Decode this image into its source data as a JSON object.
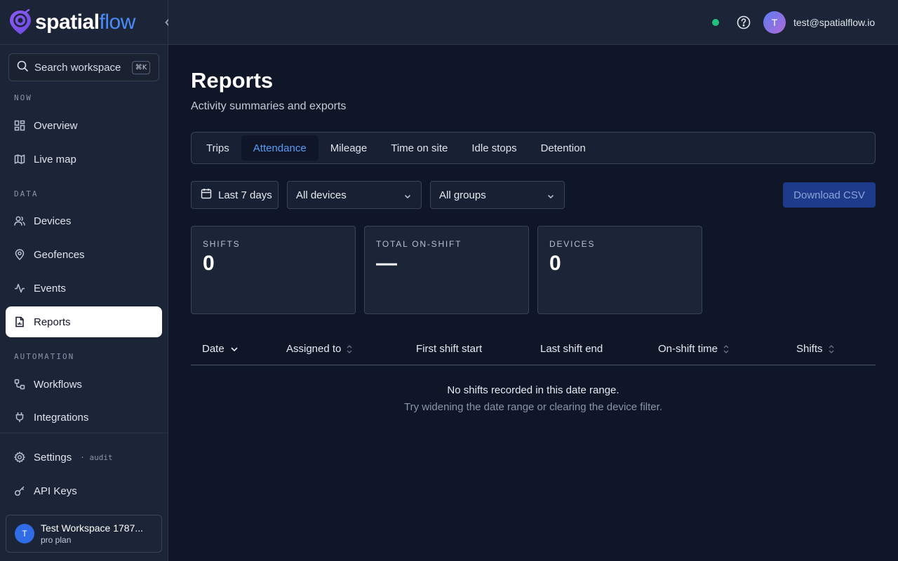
{
  "brand": {
    "word_part1": "spatial",
    "word_part2": "flow"
  },
  "search": {
    "placeholder": "Search workspace",
    "shortcut": "⌘K"
  },
  "sidebar": {
    "sections": {
      "now": "NOW",
      "data": "DATA",
      "automation": "AUTOMATION"
    },
    "items": [
      {
        "label": "Overview"
      },
      {
        "label": "Live map"
      },
      {
        "label": "Devices"
      },
      {
        "label": "Geofences"
      },
      {
        "label": "Events"
      },
      {
        "label": "Reports"
      },
      {
        "label": "Workflows"
      },
      {
        "label": "Integrations"
      },
      {
        "label": "Settings",
        "tag": "· audit"
      },
      {
        "label": "API Keys"
      }
    ],
    "workspace": {
      "avatar": "T",
      "name": "Test Workspace 1787...",
      "plan": "pro plan"
    }
  },
  "topbar": {
    "status_color": "#22c07a",
    "avatar": "T",
    "email": "test@spatialflow.io"
  },
  "page": {
    "title": "Reports",
    "subtitle": "Activity summaries and exports"
  },
  "tabs": [
    {
      "label": "Trips"
    },
    {
      "label": "Attendance"
    },
    {
      "label": "Mileage"
    },
    {
      "label": "Time on site"
    },
    {
      "label": "Idle stops"
    },
    {
      "label": "Detention"
    }
  ],
  "active_tab": "Attendance",
  "filters": {
    "date": "Last 7 days",
    "devices": "All devices",
    "groups": "All groups"
  },
  "download_label": "Download CSV",
  "stats": [
    {
      "label": "SHIFTS",
      "value": "0"
    },
    {
      "label": "TOTAL ON-SHIFT",
      "value": "—"
    },
    {
      "label": "DEVICES",
      "value": "0"
    }
  ],
  "table": {
    "columns": [
      "Date",
      "Assigned to",
      "First shift start",
      "Last shift end",
      "On-shift time",
      "Shifts"
    ],
    "empty_title": "No shifts recorded in this date range.",
    "empty_hint": "Try widening the date range or clearing the device filter."
  },
  "colors": {
    "accent": "#4a8cf7",
    "active_tab_text": "#5b9cf8",
    "primary_button": "#1e3a8a"
  }
}
